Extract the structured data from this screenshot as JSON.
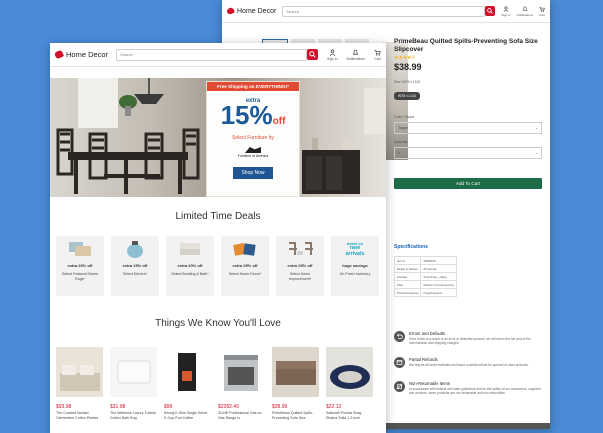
{
  "app": {
    "logo_text": "Home Decor",
    "search_placeholder": "Search"
  },
  "header_icons": [
    {
      "name": "account",
      "label": "Sign In"
    },
    {
      "name": "bell",
      "label": "Notifications"
    },
    {
      "name": "cart",
      "label": "Cart"
    }
  ],
  "banner": {
    "strip": "Free Shipping on EVERYTHING!*",
    "extra": "extra",
    "percent": "15%",
    "off": "off",
    "select": "Select Furniture by",
    "brand": "Furniture of America",
    "button": "Shop Now"
  },
  "deals_title": "Limited Time Deals",
  "deals": [
    {
      "pct": "extra 20% off",
      "label": "Select Featured Brand Rugs*",
      "icon": "rugs"
    },
    {
      "pct": "extra 15% off",
      "label": "Select Kitchen*",
      "icon": "kettle"
    },
    {
      "pct": "extra 20% off",
      "label": "Select Bedding & Bath*",
      "icon": "bedding"
    },
    {
      "pct": "extra 25% off",
      "label": "Select Home Decor*",
      "icon": "pillows"
    },
    {
      "pct": "extra 25% off",
      "label": "Select Home Improvement*",
      "icon": "chairs"
    },
    {
      "new_line1": "deals on",
      "new_line2": "new",
      "new_line3": "arrivals",
      "pct": "huge savings",
      "label": "On Fresh Inventory"
    }
  ],
  "love_title": "Things We Know You'll Love",
  "products": [
    {
      "price": "$93.98",
      "name": "The Curated Nomad Clementine Cotton Printed",
      "icon": "bedroom"
    },
    {
      "price": "$31.98",
      "name": "The Wellness Luxury Turkish Cotton Bath Rug",
      "icon": "bath-rug"
    },
    {
      "price": "$99",
      "name": "Keurig K-Slim Single Serve K-Cup Pod Coffee",
      "icon": "coffee-maker"
    },
    {
      "price": "$2282.49",
      "name": "ZLINE Professional Gas on Gas Range in",
      "icon": "range"
    },
    {
      "price": "$38.99",
      "name": "PrimeBeau Quilted Spills-Preventing Sofa Size",
      "icon": "sofa"
    },
    {
      "price": "$22.12",
      "name": "Safavieh Florida Shag Shaina Solid 1.2-inch",
      "icon": "rug"
    }
  ],
  "detail": {
    "title": "PrimeBeau Quilted Spills-Preventing Sofa Size Slipcover",
    "stars": "★★★★½",
    "price": "$38.99",
    "size_label": "Size: W75 x L110",
    "size_pill": "W75 x L110",
    "color_label": "Color: Taupe",
    "color_value": "Taupe",
    "qty_label": "Quantity",
    "qty_value": "1",
    "cart": "Add To Cart",
    "specs_title": "Specifications",
    "specs": [
      [
        "Item #",
        "26596570"
      ],
      [
        "Ready to Deliver",
        "All Venues"
      ],
      [
        "Lifestyle",
        "Smell Free + Zippy"
      ],
      [
        "Style",
        "Modern & Contemporary"
      ],
      [
        "Product Features",
        "Fingerbrayants"
      ]
    ],
    "features": [
      {
        "title": "Errors and Defaults",
        "text": "If the return is a result of an error or defective product, we will return the full cost of the merchandise and shipping charges.",
        "icon": "return"
      },
      {
        "title": "Partial Refunds",
        "text": "We require all other materials and issue a partial refund for opened or used products.",
        "icon": "refund"
      },
      {
        "title": "Non-Returnable Items",
        "text": "In accordance with federal and state guidelines and for the safety of our consumers, suppliers and vendors, some products are non-returnable and non-refundable.",
        "icon": "no-return"
      }
    ]
  },
  "colors": {
    "brand_red": "#d0112b",
    "promo_blue": "#1f5592",
    "cart_green": "#1d6b47",
    "background": "#4a8ad6"
  }
}
